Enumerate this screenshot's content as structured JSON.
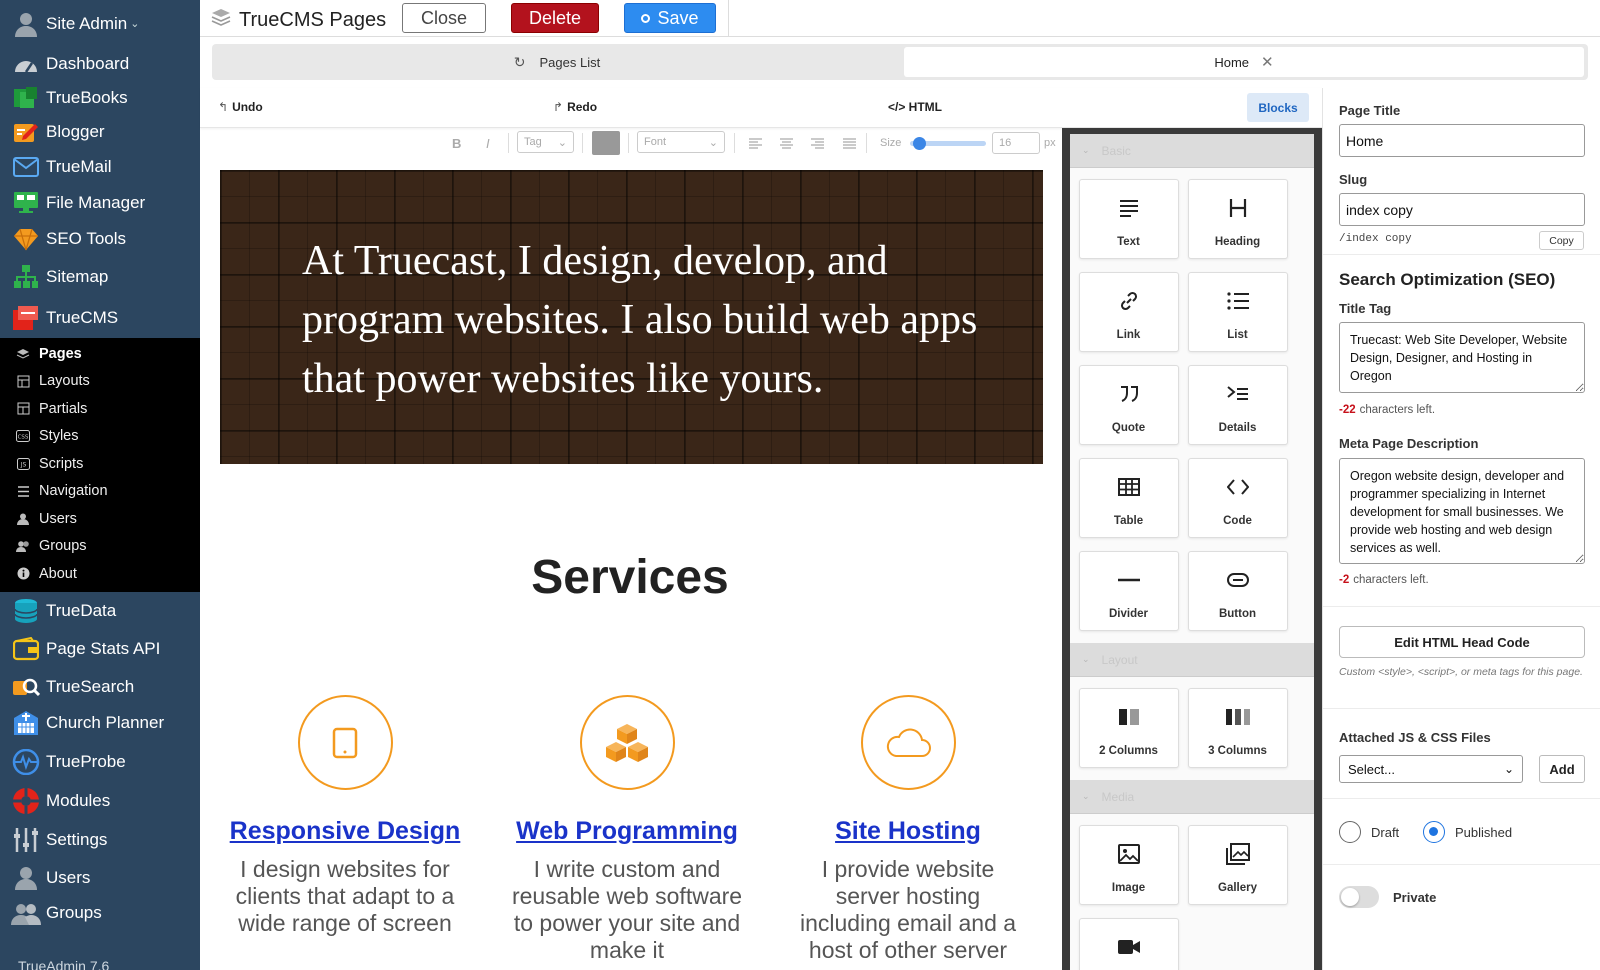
{
  "sidebar": {
    "account": "Site Admin",
    "items_top": [
      {
        "label": "Dashboard",
        "icon": "dashboard-gauge-icon"
      },
      {
        "label": "TrueBooks",
        "icon": "truebooks-money-icon"
      },
      {
        "label": "Blogger",
        "icon": "blogger-pen-icon"
      },
      {
        "label": "TrueMail",
        "icon": "truemail-envelope-icon"
      },
      {
        "label": "File Manager",
        "icon": "file-manager-icon"
      },
      {
        "label": "SEO Tools",
        "icon": "seo-diamond-icon"
      },
      {
        "label": "Sitemap",
        "icon": "sitemap-icon"
      },
      {
        "label": "TrueCMS",
        "icon": "truecms-icon"
      }
    ],
    "sub_items": [
      {
        "label": "Pages",
        "icon": "pages-icon",
        "active": true
      },
      {
        "label": "Layouts",
        "icon": "layouts-icon"
      },
      {
        "label": "Partials",
        "icon": "partials-icon"
      },
      {
        "label": "Styles",
        "icon": "css-icon"
      },
      {
        "label": "Scripts",
        "icon": "js-icon"
      },
      {
        "label": "Navigation",
        "icon": "navigation-icon"
      },
      {
        "label": "Users",
        "icon": "user-icon"
      },
      {
        "label": "Groups",
        "icon": "groups-icon"
      },
      {
        "label": "About",
        "icon": "info-icon"
      }
    ],
    "items_bottom": [
      {
        "label": "TrueData",
        "icon": "database-icon"
      },
      {
        "label": "Page Stats API",
        "icon": "stats-wallet-icon"
      },
      {
        "label": "TrueSearch",
        "icon": "truesearch-icon"
      },
      {
        "label": "Church Planner",
        "icon": "church-planner-icon"
      },
      {
        "label": "TrueProbe",
        "icon": "trueprobe-pulse-icon"
      },
      {
        "label": "Modules",
        "icon": "modules-icon"
      },
      {
        "label": "Settings",
        "icon": "settings-sliders-icon"
      },
      {
        "label": "Users",
        "icon": "users-icon"
      },
      {
        "label": "Groups",
        "icon": "user-groups-icon"
      }
    ],
    "version": "TrueAdmin 7.6"
  },
  "topbar": {
    "title": "TrueCMS Pages",
    "close_label": "Close",
    "delete_label": "Delete",
    "save_label": "Save"
  },
  "tabs": {
    "list_label": "Pages List",
    "home_label": "Home"
  },
  "editor_toolbar": {
    "undo": "Undo",
    "redo": "Redo",
    "html": "</> HTML",
    "blocks": "Blocks"
  },
  "format_toolbar": {
    "bold": "B",
    "italic": "I",
    "tag_placeholder": "Tag",
    "font_placeholder": "Font",
    "size_label": "Size",
    "size_value": "16",
    "unit": "px",
    "slider_level": 0.05
  },
  "canvas": {
    "hero_text": "At Truecast, I design, develop, and program websites. I also build web apps that power websites like yours.",
    "services_title": "Services",
    "services": [
      {
        "title": "Responsive Design",
        "desc": "I design websites for clients that adapt to a wide range of screen",
        "icon": "tablet-icon"
      },
      {
        "title": "Web Programming",
        "desc": "I write custom and reusable web software to power your site and make it",
        "icon": "cubes-icon"
      },
      {
        "title": "Site Hosting",
        "desc": "I provide website server hosting including email and a host of other server",
        "icon": "cloud-icon"
      }
    ]
  },
  "blocks_panel": {
    "categories": [
      {
        "name": "Basic",
        "blocks": [
          {
            "label": "Text",
            "icon": "text-lines-icon"
          },
          {
            "label": "Heading",
            "icon": "heading-icon"
          },
          {
            "label": "Link",
            "icon": "link-icon"
          },
          {
            "label": "List",
            "icon": "list-icon"
          },
          {
            "label": "Quote",
            "icon": "quote-icon"
          },
          {
            "label": "Details",
            "icon": "details-icon"
          },
          {
            "label": "Table",
            "icon": "table-icon"
          },
          {
            "label": "Code",
            "icon": "code-icon"
          },
          {
            "label": "Divider",
            "icon": "divider-icon"
          },
          {
            "label": "Button",
            "icon": "button-icon"
          }
        ]
      },
      {
        "name": "Layout",
        "blocks": [
          {
            "label": "2 Columns",
            "icon": "two-columns-icon"
          },
          {
            "label": "3 Columns",
            "icon": "three-columns-icon"
          }
        ]
      },
      {
        "name": "Media",
        "blocks": [
          {
            "label": "Image",
            "icon": "image-icon"
          },
          {
            "label": "Gallery",
            "icon": "gallery-icon"
          },
          {
            "label": "",
            "icon": "video-icon"
          }
        ]
      }
    ]
  },
  "properties": {
    "page_title_label": "Page Title",
    "page_title_value": "Home",
    "slug_label": "Slug",
    "slug_value": "index copy",
    "slug_preview": "/index copy",
    "copy_label": "Copy",
    "seo_heading": "Search Optimization (SEO)",
    "title_tag_label": "Title Tag",
    "title_tag_value": "Truecast: Web Site Developer, Website Design, Designer, and Hosting in Oregon",
    "title_tag_remaining": "-22",
    "chars_left_text": "characters left.",
    "meta_label": "Meta Page Description",
    "meta_value": "Oregon website design, developer and programmer specializing in Internet development for small businesses. We provide web hosting and web design services as well.",
    "meta_remaining": "-2",
    "head_code_button": "Edit HTML Head Code",
    "head_code_help": "Custom <style>, <script>, or meta tags for this page.",
    "attached_label": "Attached JS & CSS Files",
    "attached_select": "Select...",
    "add_label": "Add",
    "status_draft": "Draft",
    "status_published": "Published",
    "status_selected": "Published",
    "private_label": "Private",
    "private_on": false
  },
  "colors": {
    "sidebar_bg": "#2c4660",
    "delete_red": "#b3121d",
    "save_blue": "#2d8cf0",
    "accent_orange": "#f39a1f",
    "link_blue": "#1a33c9"
  }
}
